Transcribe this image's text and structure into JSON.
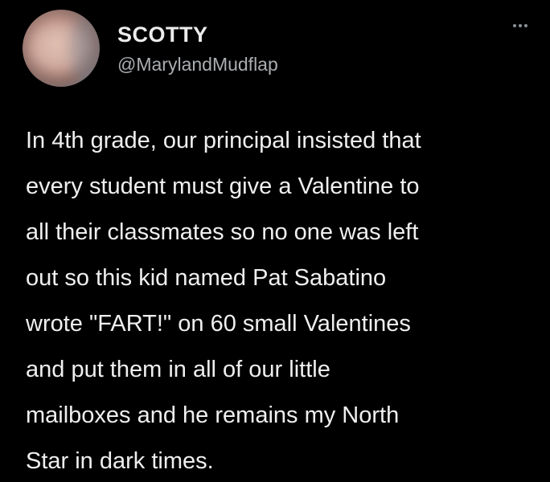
{
  "tweet": {
    "author_name": "SCOTTY",
    "author_handle": "@MarylandMudflap",
    "more_icon": "more-horizontal-icon",
    "text_lines": [
      "In 4th grade, our principal insisted that",
      "every student must give a Valentine to",
      "all their classmates so no one was left",
      "out so this kid named Pat Sabatino",
      "wrote \"FART!\" on 60 small Valentines",
      "and put them in all of our little",
      "mailboxes and he remains my North",
      "Star in dark times."
    ]
  },
  "colors": {
    "background": "#000000",
    "text": "#efefef",
    "secondary_text": "#a9adb1"
  }
}
